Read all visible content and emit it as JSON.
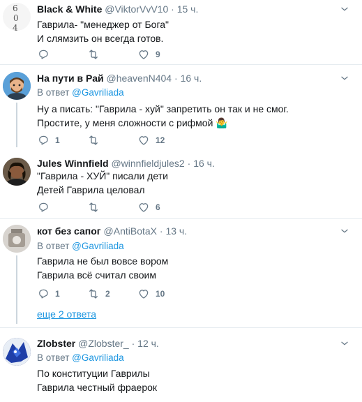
{
  "tweets": [
    {
      "name": "Black & White",
      "handle": "@ViktorVvV10",
      "dot": "·",
      "time": "15 ч.",
      "reply_prefix": "",
      "reply_to": "",
      "lines": [
        "Гаврила- \"менеджер от Бога\"",
        "И слямзить он всегда готов."
      ],
      "replies": "",
      "retweets": "",
      "likes": "9"
    },
    {
      "name": "На пути в Рай",
      "handle": "@heavenN404",
      "dot": "·",
      "time": "16 ч.",
      "reply_prefix": "В ответ ",
      "reply_to": "@Gavriliada",
      "lines": [
        "Ну а писать: \"Гаврила - хуй\" запретить он так и не смог.",
        "Простите, у меня сложности с рифмой 🤷‍♂️"
      ],
      "replies": "1",
      "retweets": "",
      "likes": "12"
    },
    {
      "name": "Jules Winnfield",
      "handle": "@winnfieldjules2",
      "dot": "·",
      "time": "16 ч.",
      "reply_prefix": "",
      "reply_to": "",
      "lines": [
        "\"Гаврила - ХУЙ\" писали дети",
        "Детей Гаврила целовал"
      ],
      "replies": "",
      "retweets": "",
      "likes": "6"
    },
    {
      "name": "кот без сапог",
      "handle": "@AntiBotaX",
      "dot": "·",
      "time": "13 ч.",
      "reply_prefix": "В ответ ",
      "reply_to": "@Gavriliada",
      "lines": [
        "Гаврила не был вовсе вором",
        "Гаврила всё считал своим"
      ],
      "replies": "1",
      "retweets": "2",
      "likes": "10"
    },
    {
      "name": "Zlobster",
      "handle": "@Zlobster_",
      "dot": "·",
      "time": "12 ч.",
      "reply_prefix": "В ответ ",
      "reply_to": "@Gavriliada",
      "lines": [
        "По конституции Гаврилы",
        "Гаврила честный фраерок"
      ],
      "replies": "",
      "retweets": "",
      "likes": ""
    }
  ],
  "more_replies_label": "еще 2 ответа",
  "colors": {
    "accent": "#1b95e0",
    "muted": "#657786",
    "text": "#14171a",
    "separator": "#e6ecf0"
  },
  "icons": [
    "reply-icon",
    "retweet-icon",
    "like-icon",
    "chevron-down-icon"
  ]
}
